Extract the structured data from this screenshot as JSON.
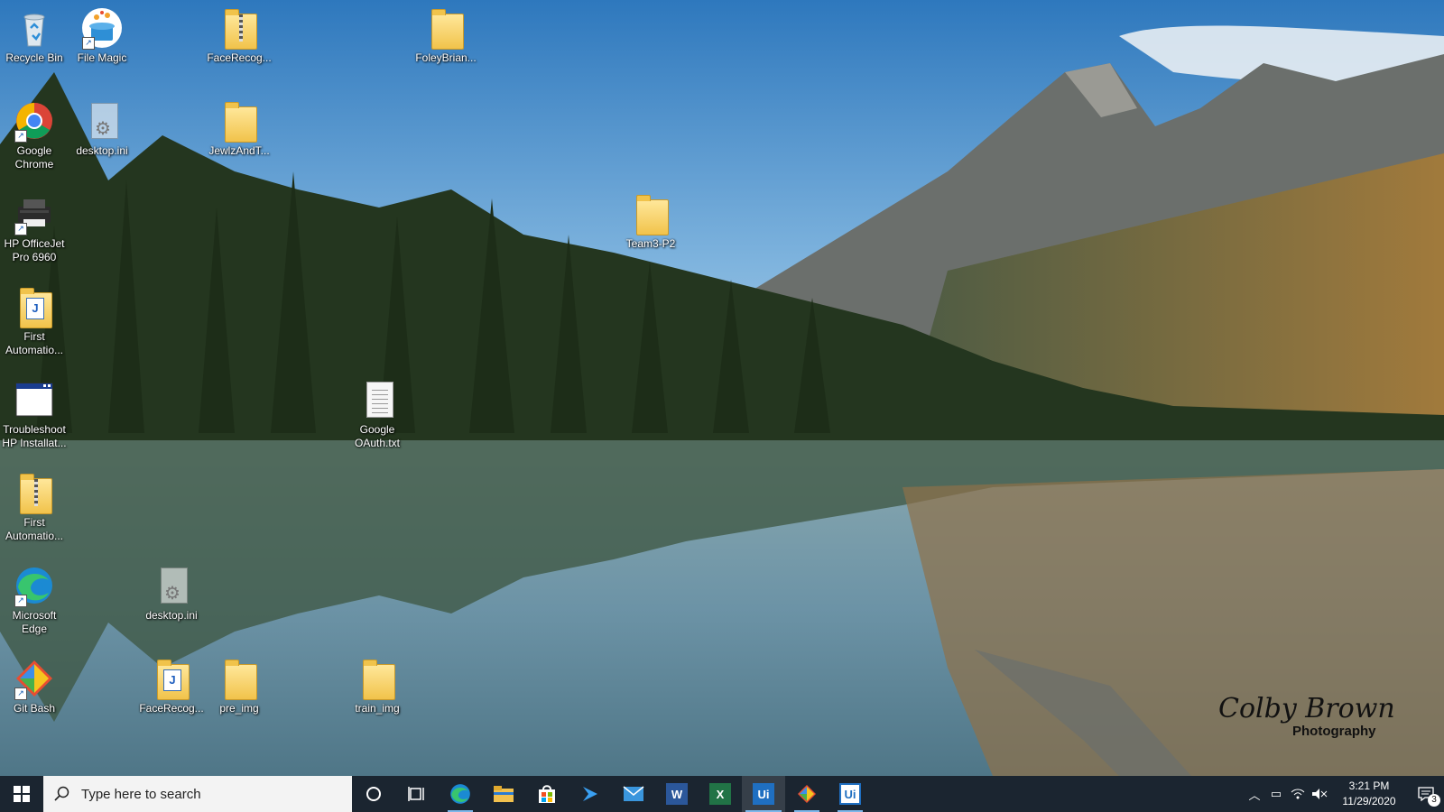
{
  "desktop_icons": [
    {
      "label": "Recycle Bin",
      "icon": "recycle-bin-icon"
    },
    {
      "label": "File Magic",
      "icon": "file-magic-icon"
    },
    {
      "label": "FaceRecog...",
      "icon": "zip-folder-icon"
    },
    {
      "label": "FoleyBrian...",
      "icon": "folder-icon"
    },
    {
      "label": "Google Chrome",
      "icon": "chrome-icon"
    },
    {
      "label": "desktop.ini",
      "icon": "settings-file-icon"
    },
    {
      "label": "JewlzAndT...",
      "icon": "folder-icon"
    },
    {
      "label": "Team3-P2",
      "icon": "folder-icon"
    },
    {
      "label": "HP OfficeJet Pro 6960",
      "icon": "printer-icon"
    },
    {
      "label": "First Automatio...",
      "icon": "uipath-project-icon"
    },
    {
      "label": "Troubleshoot HP Installat...",
      "icon": "window-app-icon"
    },
    {
      "label": "Google OAuth.txt",
      "icon": "text-file-icon"
    },
    {
      "label": "First Automatio...",
      "icon": "zip-folder-icon"
    },
    {
      "label": "Microsoft Edge",
      "icon": "edge-icon"
    },
    {
      "label": "desktop.ini",
      "icon": "settings-file-icon"
    },
    {
      "label": "Git Bash",
      "icon": "git-bash-icon"
    },
    {
      "label": "FaceRecog...",
      "icon": "uipath-project-icon"
    },
    {
      "label": "pre_img",
      "icon": "folder-icon"
    },
    {
      "label": "train_img",
      "icon": "folder-icon"
    }
  ],
  "taskbar": {
    "search_placeholder": "Type here to search",
    "apps": [
      {
        "name": "Cortana",
        "icon": "cortana-circle-icon"
      },
      {
        "name": "Task View",
        "icon": "task-view-icon"
      },
      {
        "name": "Microsoft Edge",
        "icon": "edge-icon"
      },
      {
        "name": "File Explorer",
        "icon": "folder-icon"
      },
      {
        "name": "Microsoft Store",
        "icon": "store-icon"
      },
      {
        "name": "Visual Studio",
        "icon": "visual-studio-icon"
      },
      {
        "name": "Mail",
        "icon": "mail-icon"
      },
      {
        "name": "Word",
        "icon": "word-icon",
        "glyph": "W"
      },
      {
        "name": "Excel",
        "icon": "excel-icon",
        "glyph": "X"
      },
      {
        "name": "UiPath Studio",
        "icon": "uipath-studio-icon",
        "glyph": "Ui"
      },
      {
        "name": "Git",
        "icon": "git-icon"
      },
      {
        "name": "UiPath Assistant",
        "icon": "uipath-assistant-icon",
        "glyph": "Ui"
      }
    ],
    "clock": {
      "time": "3:21 PM",
      "date": "11/29/2020"
    },
    "notification_count": "3"
  },
  "watermark": {
    "signature": "Colby Brown",
    "text": "Photography"
  },
  "colors": {
    "taskbar_bg": "#1b2530",
    "accent": "#7db7ea",
    "sky": "#2f7fc0"
  }
}
